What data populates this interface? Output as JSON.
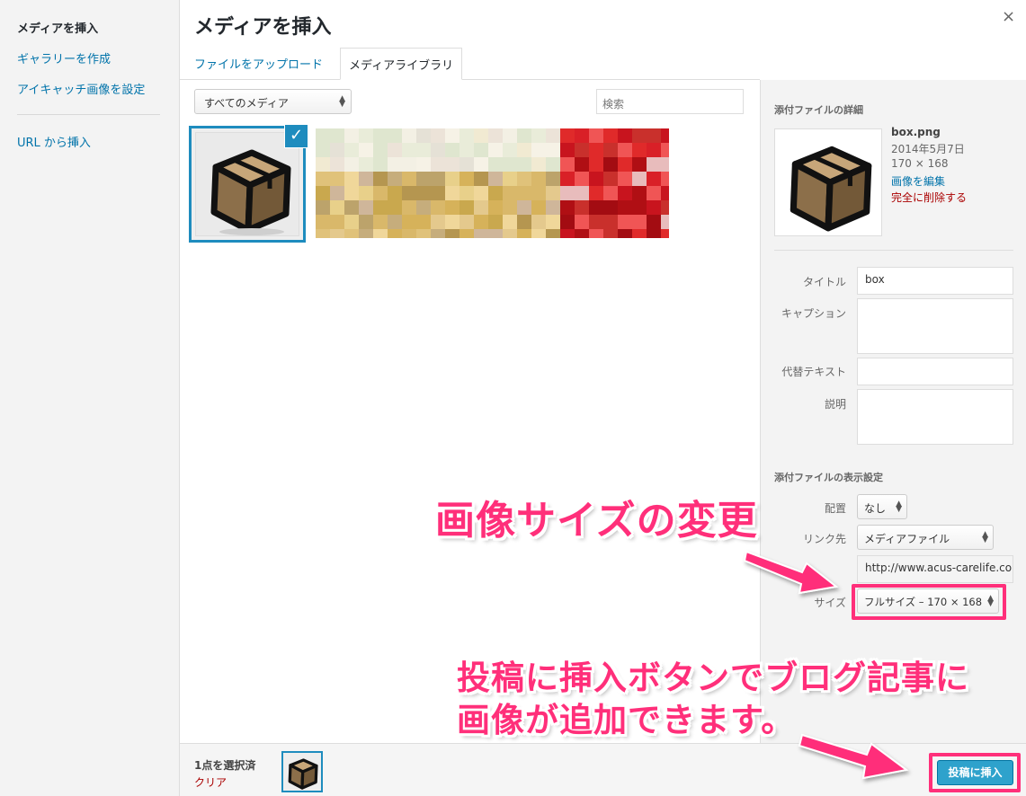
{
  "menu": {
    "active": "メディアを挿入",
    "gallery": "ギャラリーを作成",
    "featured": "アイキャッチ画像を設定",
    "url": "URL から挿入"
  },
  "modal": {
    "title": "メディアを挿入",
    "close_icon": "×"
  },
  "tabs": {
    "upload": "ファイルをアップロード",
    "library": "メディアライブラリ"
  },
  "toolbar": {
    "filter_value": "すべてのメディア",
    "search_placeholder": "検索"
  },
  "details": {
    "heading": "添付ファイルの詳細",
    "filename": "box.png",
    "date": "2014年5月7日",
    "dimensions": "170 × 168",
    "edit_link": "画像を編集",
    "delete_link": "完全に削除する",
    "title_label": "タイトル",
    "title_value": "box",
    "caption_label": "キャプション",
    "alt_label": "代替テキスト",
    "desc_label": "説明"
  },
  "display": {
    "heading": "添付ファイルの表示設定",
    "align_label": "配置",
    "align_value": "なし",
    "link_label": "リンク先",
    "link_value": "メディアファイル",
    "url_value": "http://www.acus-carelife.cor",
    "size_label": "サイズ",
    "size_value": "フルサイズ – 170 × 168"
  },
  "footer": {
    "selected": "1点を選択済",
    "clear": "クリア",
    "insert": "投稿に挿入"
  },
  "annotations": {
    "size_note": "画像サイズの変更",
    "insert_note_1": "投稿に挿入ボタンでブログ記事に",
    "insert_note_2": "画像が追加できます。"
  },
  "colors": {
    "accent": "#1e8cbe",
    "annotation": "#ff2f7a",
    "button": "#2ea2cc",
    "delete": "#aa0000"
  }
}
